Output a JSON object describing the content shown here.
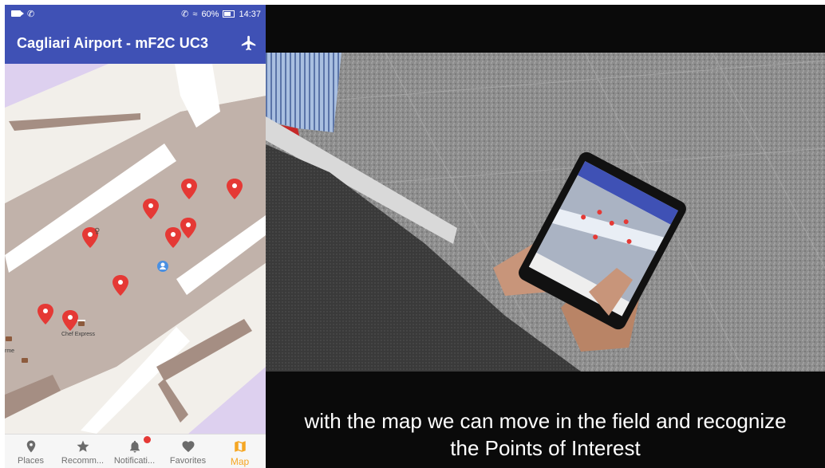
{
  "status_bar": {
    "battery": "60%",
    "time": "14:37"
  },
  "app": {
    "title": "Cagliari Airport - mF2C UC3"
  },
  "map": {
    "poi_labels": [
      "Chef Express",
      "rme"
    ]
  },
  "bottom_nav": [
    {
      "label": "Places",
      "icon": "place-icon",
      "active": false
    },
    {
      "label": "Recomm...",
      "icon": "star-icon",
      "active": false
    },
    {
      "label": "Notificati...",
      "icon": "bell-icon",
      "active": false
    },
    {
      "label": "Favorites",
      "icon": "heart-icon",
      "active": false
    },
    {
      "label": "Map",
      "icon": "map-icon",
      "active": true
    }
  ],
  "video": {
    "caption_line1": "with the map we can move in the field and recognize",
    "caption_line2": "the Points of Interest"
  },
  "colors": {
    "app_bar": "#3f51b5",
    "active_nav": "#f5a623",
    "marker": "#e53935",
    "notification_dot": "#e53935"
  }
}
